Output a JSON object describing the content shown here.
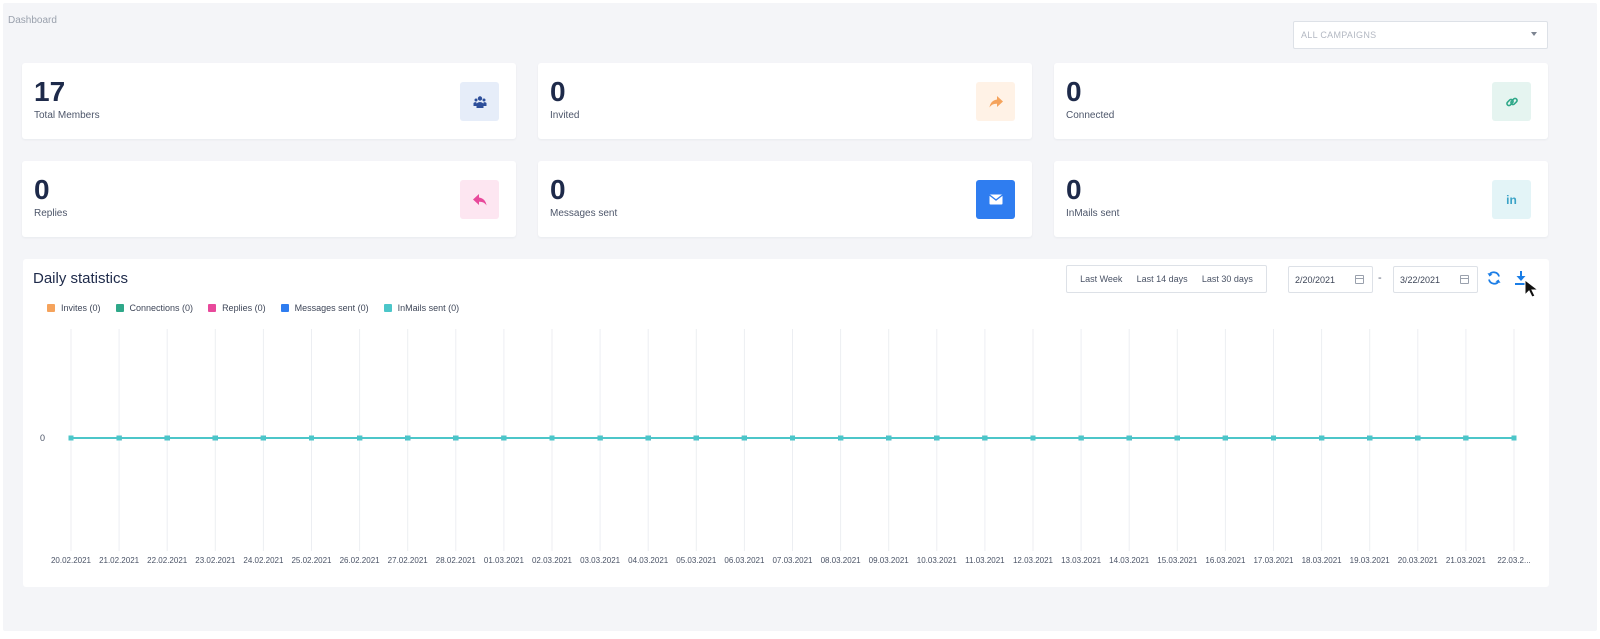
{
  "breadcrumb": "Dashboard",
  "campaign_filter": {
    "value": "ALL CAMPAIGNS"
  },
  "stats": [
    {
      "value": "17",
      "label": "Total Members",
      "icon": "users-icon",
      "bg": "#e6edf9",
      "fg": "#2d4e9a"
    },
    {
      "value": "0",
      "label": "Invited",
      "icon": "share-arrow-icon",
      "bg": "#fff2e6",
      "fg": "#f5a35c"
    },
    {
      "value": "0",
      "label": "Connected",
      "icon": "link-icon",
      "bg": "#e5f4f0",
      "fg": "#2fa889"
    },
    {
      "value": "0",
      "label": "Replies",
      "icon": "reply-icon",
      "bg": "#fde6f1",
      "fg": "#e8499b"
    },
    {
      "value": "0",
      "label": "Messages sent",
      "icon": "envelope-icon",
      "bg": "#e3eefc",
      "fg": "#2f7df0"
    },
    {
      "value": "0",
      "label": "InMails sent",
      "icon": "linkedin-icon",
      "bg": "#e3f4f7",
      "fg": "#3ba3c7"
    }
  ],
  "daily_stats": {
    "title": "Daily statistics",
    "range_buttons": [
      "Last Week",
      "Last 14 days",
      "Last 30 days"
    ],
    "date_from": "2/20/2021",
    "date_to": "3/22/2021",
    "date_separator": "-"
  },
  "chart_data": {
    "type": "line",
    "x": [
      "20.02.2021",
      "21.02.2021",
      "22.02.2021",
      "23.02.2021",
      "24.02.2021",
      "25.02.2021",
      "26.02.2021",
      "27.02.2021",
      "28.02.2021",
      "01.03.2021",
      "02.03.2021",
      "03.03.2021",
      "04.03.2021",
      "05.03.2021",
      "06.03.2021",
      "07.03.2021",
      "08.03.2021",
      "09.03.2021",
      "10.03.2021",
      "11.03.2021",
      "12.03.2021",
      "13.03.2021",
      "14.03.2021",
      "15.03.2021",
      "16.03.2021",
      "17.03.2021",
      "18.03.2021",
      "19.03.2021",
      "20.03.2021",
      "21.03.2021",
      "22.03.2..."
    ],
    "y_tick_labels": [
      "0"
    ],
    "series": [
      {
        "name": "Invites (0)",
        "color": "#f5a35c",
        "values": [
          0,
          0,
          0,
          0,
          0,
          0,
          0,
          0,
          0,
          0,
          0,
          0,
          0,
          0,
          0,
          0,
          0,
          0,
          0,
          0,
          0,
          0,
          0,
          0,
          0,
          0,
          0,
          0,
          0,
          0,
          0
        ]
      },
      {
        "name": "Connections (0)",
        "color": "#2fa889",
        "values": [
          0,
          0,
          0,
          0,
          0,
          0,
          0,
          0,
          0,
          0,
          0,
          0,
          0,
          0,
          0,
          0,
          0,
          0,
          0,
          0,
          0,
          0,
          0,
          0,
          0,
          0,
          0,
          0,
          0,
          0,
          0
        ]
      },
      {
        "name": "Replies (0)",
        "color": "#e8499b",
        "values": [
          0,
          0,
          0,
          0,
          0,
          0,
          0,
          0,
          0,
          0,
          0,
          0,
          0,
          0,
          0,
          0,
          0,
          0,
          0,
          0,
          0,
          0,
          0,
          0,
          0,
          0,
          0,
          0,
          0,
          0,
          0
        ]
      },
      {
        "name": "Messages sent (0)",
        "color": "#2f7df0",
        "values": [
          0,
          0,
          0,
          0,
          0,
          0,
          0,
          0,
          0,
          0,
          0,
          0,
          0,
          0,
          0,
          0,
          0,
          0,
          0,
          0,
          0,
          0,
          0,
          0,
          0,
          0,
          0,
          0,
          0,
          0,
          0
        ]
      },
      {
        "name": "InMails sent (0)",
        "color": "#4cc6c9",
        "values": [
          0,
          0,
          0,
          0,
          0,
          0,
          0,
          0,
          0,
          0,
          0,
          0,
          0,
          0,
          0,
          0,
          0,
          0,
          0,
          0,
          0,
          0,
          0,
          0,
          0,
          0,
          0,
          0,
          0,
          0,
          0
        ]
      }
    ],
    "grid": true,
    "legend_position": "top-left"
  }
}
